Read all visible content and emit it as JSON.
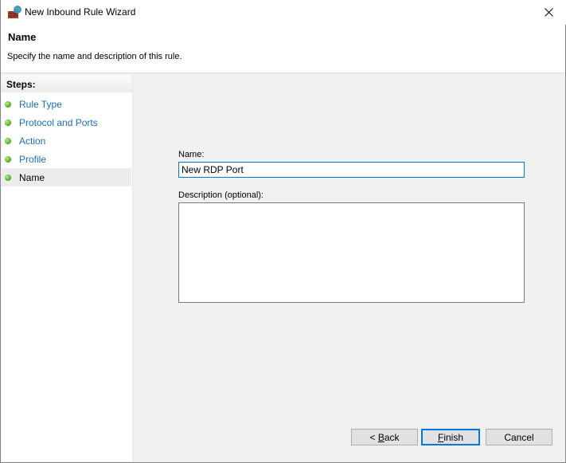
{
  "window": {
    "title": "New Inbound Rule Wizard",
    "icon": "firewall-globe-icon",
    "close_icon": "close-icon"
  },
  "header": {
    "title": "Name",
    "subtitle": "Specify the name and description of this rule."
  },
  "steps": {
    "heading": "Steps:",
    "items": [
      {
        "label": "Rule Type",
        "current": false
      },
      {
        "label": "Protocol and Ports",
        "current": false
      },
      {
        "label": "Action",
        "current": false
      },
      {
        "label": "Profile",
        "current": false
      },
      {
        "label": "Name",
        "current": true
      }
    ]
  },
  "form": {
    "name_label": "Name:",
    "name_value": "New RDP Port",
    "description_label": "Description (optional):",
    "description_value": ""
  },
  "buttons": {
    "back": {
      "prefix": "< ",
      "mnemonic": "B",
      "rest": "ack"
    },
    "finish": {
      "prefix": "",
      "mnemonic": "F",
      "rest": "inish"
    },
    "cancel": {
      "label": "Cancel"
    }
  },
  "colors": {
    "accent": "#0078d7",
    "link": "#1a6fb5",
    "step_done": "#4aa61c"
  }
}
